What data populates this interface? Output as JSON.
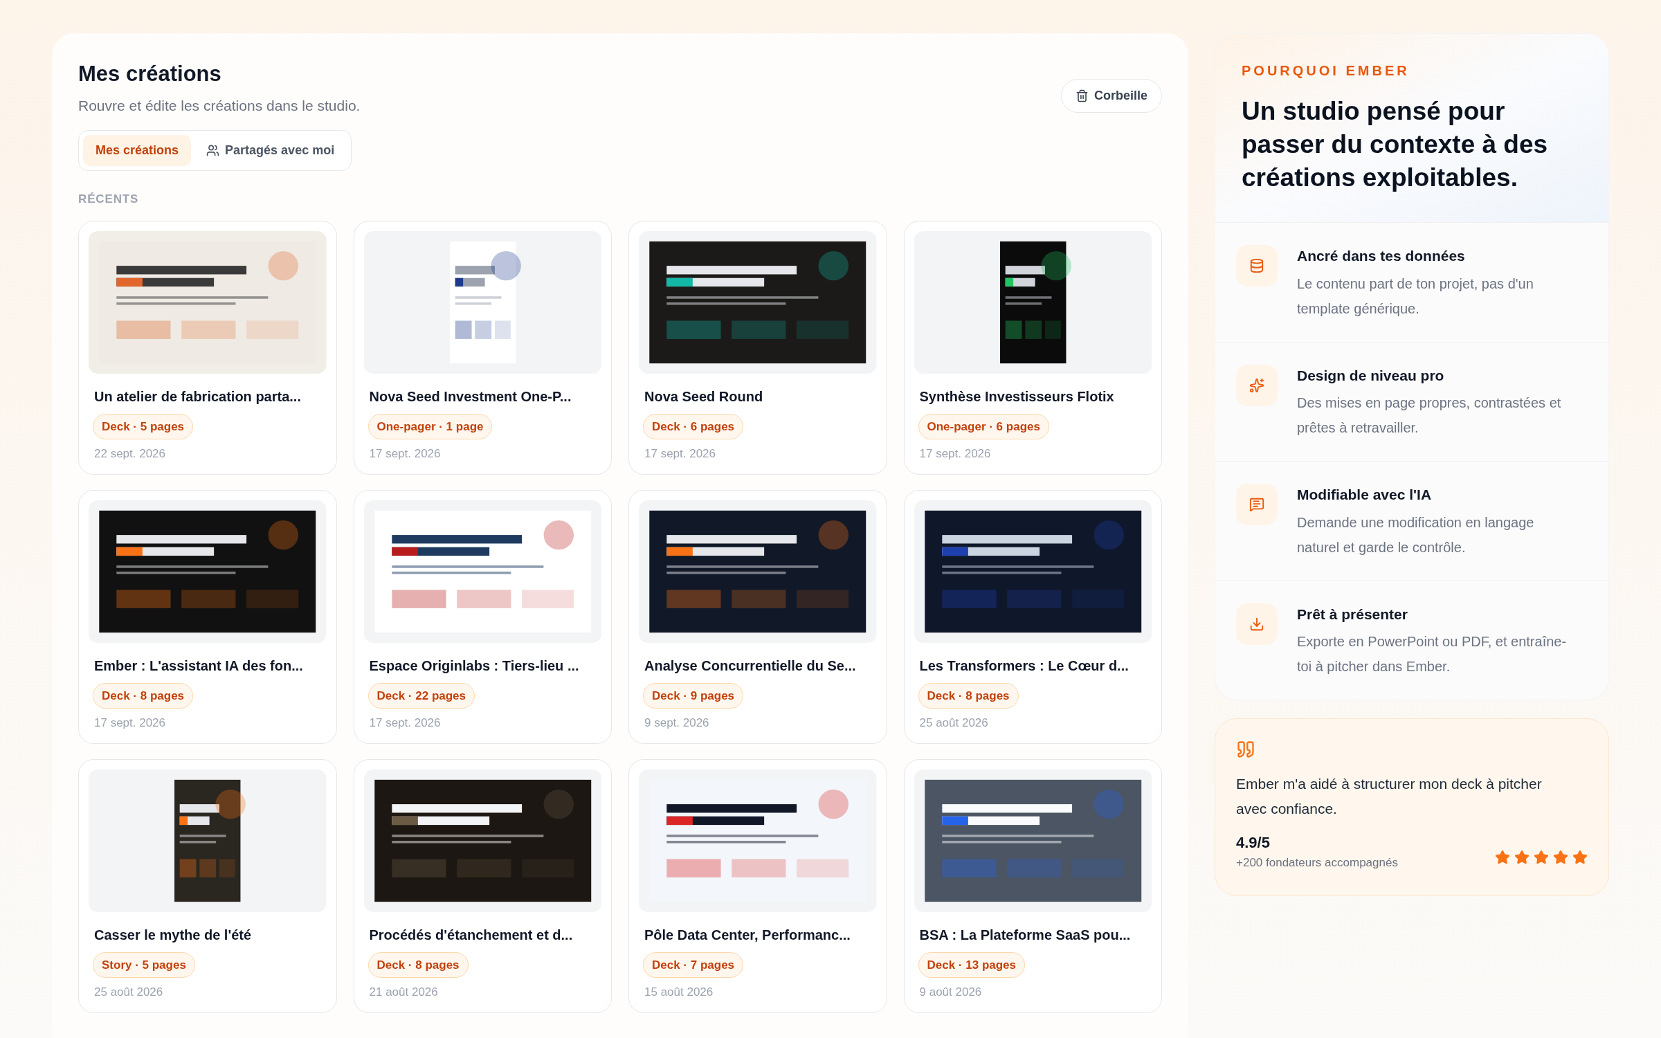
{
  "main": {
    "title": "Mes créations",
    "subtitle": "Rouvre et édite les créations dans le studio.",
    "trash_button": "Corbeille",
    "tabs": [
      {
        "label": "Mes créations",
        "selected": true,
        "kind": "plain"
      },
      {
        "label": "Partagés avec moi",
        "selected": false,
        "kind": "shared"
      }
    ],
    "section_label": "RÉCENTS",
    "cards": [
      {
        "title": "Un atelier de fabrication parta...",
        "badge": "Deck · 5 pages",
        "date": "22 sept. 2026"
      },
      {
        "title": "Nova Seed Investment One-P...",
        "badge": "One-pager · 1 page",
        "date": "17 sept. 2026"
      },
      {
        "title": "Nova Seed Round",
        "badge": "Deck · 6 pages",
        "date": "17 sept. 2026"
      },
      {
        "title": "Synthèse Investisseurs Flotix",
        "badge": "One-pager · 6 pages",
        "date": "17 sept. 2026"
      },
      {
        "title": "Ember : L'assistant IA des fon...",
        "badge": "Deck · 8 pages",
        "date": "17 sept. 2026"
      },
      {
        "title": "Espace Originlabs : Tiers-lieu ...",
        "badge": "Deck · 22 pages",
        "date": "17 sept. 2026"
      },
      {
        "title": "Analyse Concurrentielle du Se...",
        "badge": "Deck · 9 pages",
        "date": "9 sept. 2026"
      },
      {
        "title": "Les Transformers : Le Cœur d...",
        "badge": "Deck · 8 pages",
        "date": "25 août 2026"
      },
      {
        "title": "Casser le mythe de l'été",
        "badge": "Story · 5 pages",
        "date": "25 août 2026"
      },
      {
        "title": "Procédés d'étanchement et d...",
        "badge": "Deck · 8 pages",
        "date": "21 août 2026"
      },
      {
        "title": "Pôle Data Center, Performanc...",
        "badge": "Deck · 7 pages",
        "date": "15 août 2026"
      },
      {
        "title": "BSA : La Plateforme SaaS pou...",
        "badge": "Deck · 13 pages",
        "date": "9 août 2026"
      }
    ]
  },
  "sidebar": {
    "eyebrow": "POURQUOI EMBER",
    "heading": "Un studio pensé pour passer du contexte à des créations exploitables.",
    "features": [
      {
        "kind": "data",
        "title": "Ancré dans tes données",
        "text": "Le contenu part de ton projet, pas d'un template générique."
      },
      {
        "kind": "design",
        "title": "Design de niveau pro",
        "text": "Des mises en page propres, contrastées et prêtes à retravailler."
      },
      {
        "kind": "edit",
        "title": "Modifiable avec l'IA",
        "text": "Demande une modification en langage naturel et garde le contrôle."
      },
      {
        "kind": "export",
        "title": "Prêt à présenter",
        "text": "Exporte en PowerPoint ou PDF, et entraîne-toi à pitcher dans Ember."
      }
    ],
    "testimonial": {
      "quote": "Ember m'a aidé à structurer mon deck à pitcher avec confiance.",
      "rating": "4.9/5",
      "caption": "+200 fondateurs accompagnés",
      "stars": 5
    }
  }
}
